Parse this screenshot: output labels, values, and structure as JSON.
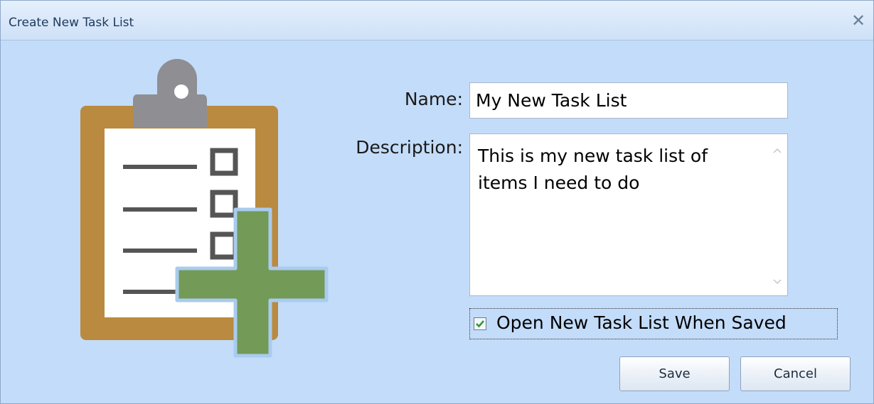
{
  "window": {
    "title": "Create New Task List",
    "close_glyph": "✕"
  },
  "form": {
    "name_label": "Name:",
    "name_value": "My New Task List",
    "description_label": "Description:",
    "description_value": "This is my new task list of\nitems I need to do",
    "open_when_saved_label": "Open New Task List When Saved",
    "open_when_saved_checked": true
  },
  "buttons": {
    "save_label": "Save",
    "cancel_label": "Cancel"
  },
  "icons": {
    "illustration": "clipboard-add-icon",
    "scroll_up": "chevron-up-icon",
    "scroll_down": "chevron-down-icon",
    "check": "checkmark-icon"
  },
  "colors": {
    "background": "#c3dcf9",
    "clipboard_board": "#b98a3f",
    "clipboard_clip": "#8e8e93",
    "plus": "#739a57",
    "check": "#2e9a2e"
  }
}
